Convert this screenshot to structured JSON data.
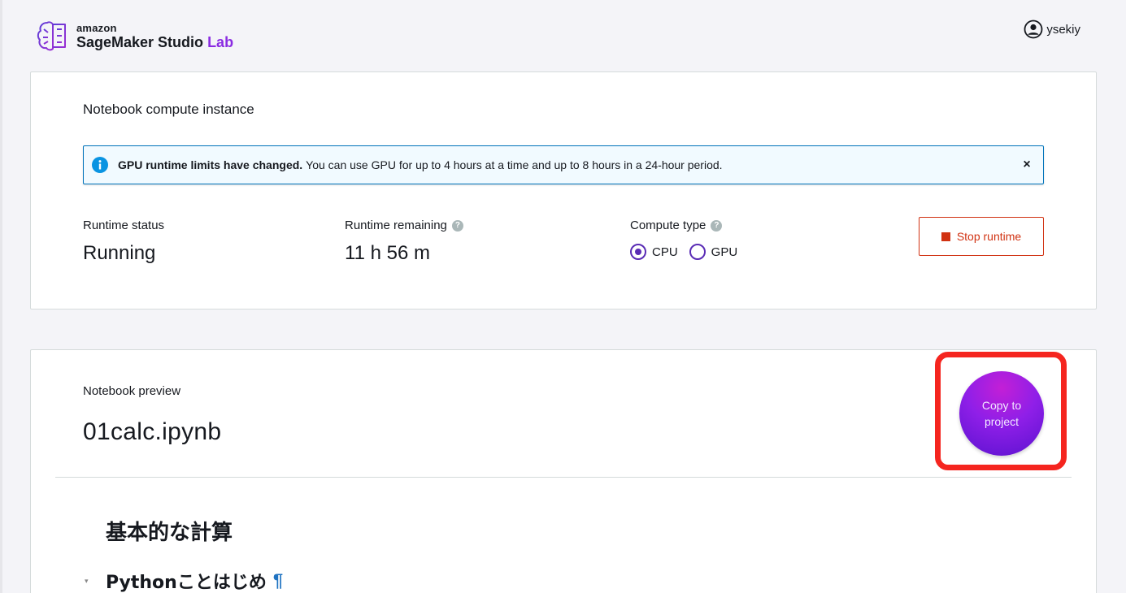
{
  "header": {
    "brand_top": "amazon",
    "brand_product": "SageMaker Studio",
    "brand_lab": "Lab",
    "user_name": "ysekiy"
  },
  "runtime_card": {
    "title": "Notebook compute instance",
    "alert": {
      "bold": "GPU runtime limits have changed.",
      "text": "You can use GPU for up to 4 hours at a time and up to 8 hours in a 24-hour period.",
      "close": "×"
    },
    "status": {
      "label": "Runtime status",
      "value": "Running"
    },
    "remaining": {
      "label": "Runtime remaining",
      "value": "11 h 56 m"
    },
    "compute_type": {
      "label": "Compute type",
      "options": [
        "CPU",
        "GPU"
      ],
      "selected": "CPU"
    },
    "stop_button": "Stop runtime",
    "help_glyph": "?"
  },
  "preview_card": {
    "label": "Notebook preview",
    "notebook_name": "01calc.ipynb",
    "copy_button": "Copy to project",
    "heading1": "基本的な計算",
    "heading2": "Pythonことはじめ",
    "pilcrow": "¶",
    "caret": "▾"
  },
  "colors": {
    "accent": "#5a2cb5",
    "danger": "#d13212",
    "info": "#0073bb",
    "highlight": "#f5251f"
  }
}
